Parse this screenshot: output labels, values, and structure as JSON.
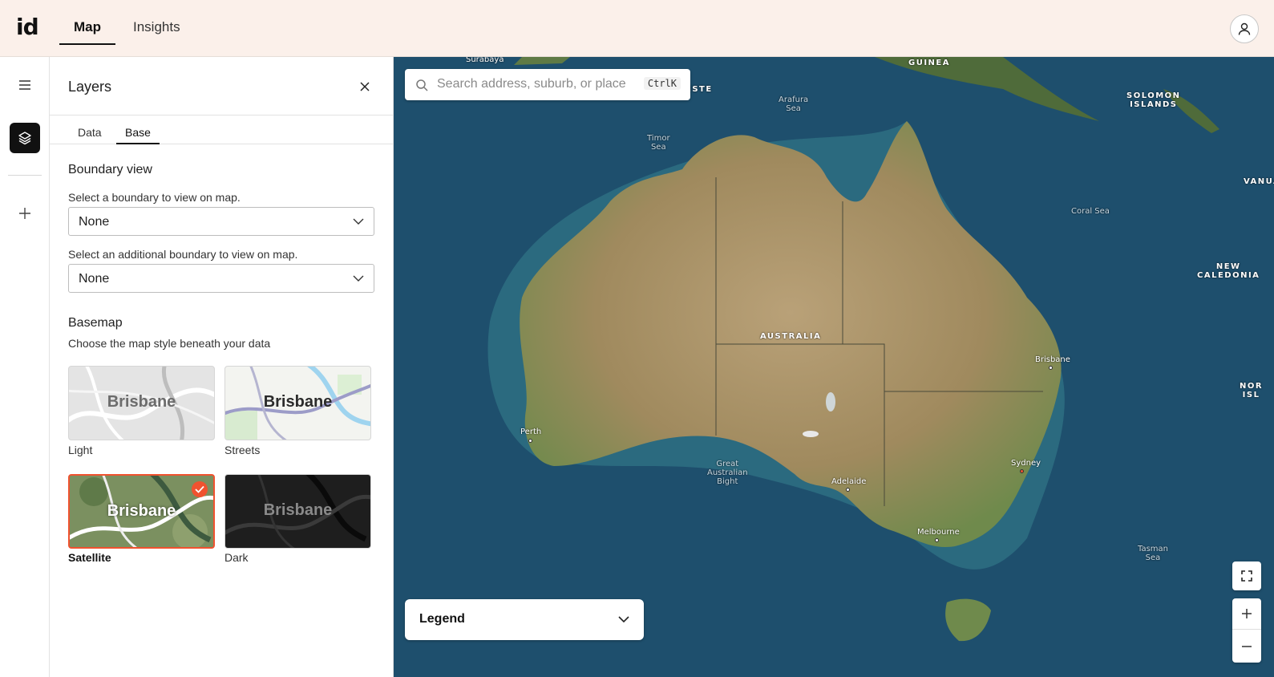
{
  "app": {
    "logo": "id"
  },
  "nav": {
    "tabs": [
      {
        "label": "Map"
      },
      {
        "label": "Insights"
      }
    ],
    "active": "Map"
  },
  "panel": {
    "title": "Layers",
    "tabs": [
      {
        "label": "Data"
      },
      {
        "label": "Base"
      }
    ],
    "active_tab": "Base",
    "boundary": {
      "title": "Boundary view",
      "primary_label": "Select a boundary to view on map.",
      "primary_value": "None",
      "additional_label": "Select an additional boundary to view on map.",
      "additional_value": "None"
    },
    "basemap": {
      "title": "Basemap",
      "subtitle": "Choose the map style beneath your data",
      "preview_text": "Brisbane",
      "options": [
        {
          "label": "Light",
          "selected": false
        },
        {
          "label": "Streets",
          "selected": false
        },
        {
          "label": "Satellite",
          "selected": true
        },
        {
          "label": "Dark",
          "selected": false
        }
      ]
    }
  },
  "map": {
    "search": {
      "placeholder": "Search address, suburb, or place",
      "shortcut": "CtrlK"
    },
    "legend": {
      "label": "Legend"
    },
    "labels": {
      "surabaya": "Surabaya",
      "guinea": "GUINEA",
      "este": "ESTE",
      "arafura": "Arafura\nSea",
      "timor": "Timor\nSea",
      "solomon": "SOLOMON\nISLANDS",
      "vanuatu": "VANUA",
      "coral": "Coral Sea",
      "new_caledonia": "NEW\nCALEDONIA",
      "australia": "AUSTRALIA",
      "brisbane": "Brisbane",
      "nor": "NOR\nISL",
      "perth": "Perth",
      "bight": "Great\nAustralian\nBight",
      "adelaide": "Adelaide",
      "sydney": "Sydney",
      "melbourne": "Melbourne",
      "tasman": "Tasman\nSea"
    }
  },
  "colors": {
    "accent": "#f0522f",
    "topbar": "#fbf0ea",
    "ocean": "#1d4f6e"
  }
}
